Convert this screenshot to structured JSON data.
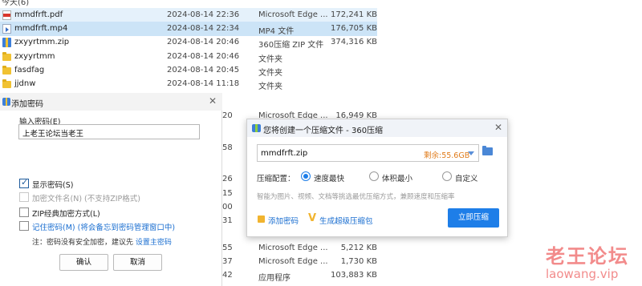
{
  "explorer": {
    "crumb": "今天(6)",
    "files": [
      {
        "name": "mmdfrft.pdf",
        "date": "2024-08-14 22:36",
        "type": "Microsoft Edge ...",
        "size": "172,241 KB",
        "icon": "pdf-icon"
      },
      {
        "name": "mmdfrft.mp4",
        "date": "2024-08-14 22:34",
        "type": "MP4 文件",
        "size": "176,705 KB",
        "icon": "mp4-icon"
      },
      {
        "name": "zxyyrtmm.zip",
        "date": "2024-08-14 20:46",
        "type": "360压缩 ZIP 文件",
        "size": "374,316 KB",
        "icon": "zip-icon"
      },
      {
        "name": "zxyyrtmm",
        "date": "2024-08-14 20:46",
        "type": "文件夹",
        "size": "",
        "icon": "folder-icon"
      },
      {
        "name": "fasdfag",
        "date": "2024-08-14 20:45",
        "type": "文件夹",
        "size": "",
        "icon": "folder-icon"
      },
      {
        "name": "jjdnw",
        "date": "2024-08-14 11:18",
        "type": "文件夹",
        "size": "",
        "icon": "folder-icon"
      }
    ],
    "partial_rows": [
      {
        "size_col": "20",
        "type": "Microsoft Edge ...",
        "size": "16,949 KB"
      },
      {
        "size_col": "58",
        "type": "",
        "size": ""
      },
      {
        "size_col": "26",
        "type": "",
        "size": ""
      },
      {
        "size_col": "15",
        "type": "",
        "size": ""
      },
      {
        "size_col": "00",
        "type": "",
        "size": ""
      },
      {
        "size_col": "31",
        "type": "",
        "size": ""
      },
      {
        "size_col": "55",
        "type": "Microsoft Edge ...",
        "size": "5,212 KB"
      },
      {
        "size_col": "37",
        "type": "Microsoft Edge ...",
        "size": "1,730 KB"
      },
      {
        "size_col": "42",
        "type": "应用程序",
        "size": "103,883 KB"
      }
    ]
  },
  "password_dialog": {
    "title": "添加密码",
    "close": "✕",
    "input_label": "输入密码(E)",
    "input_value": "上老王论坛当老王",
    "show_password": "显示密码(S)",
    "encrypt_names": "加密文件名(N) (不支持ZIP格式)",
    "zip_classic": "ZIP经典加密方式(L)",
    "remember": "记住密码(M) (将会备忘到密码管理窗口中)",
    "note": "注：密码没有安全加密，建议先 ",
    "note_link": "设置主密码",
    "ok": "确认",
    "cancel": "取消"
  },
  "zip_dialog": {
    "title": "您将创建一个压缩文件 - 360压缩",
    "close": "✕",
    "filename": "mmdfrft.zip",
    "free_space": "剩余:55.6GB",
    "config_label": "压缩配置：",
    "options": [
      "速度最快",
      "体积最小",
      "自定义"
    ],
    "selected_option": "速度最快",
    "hint": "智能为图片、视频、文档等挑选最优压缩方式，兼顾速度和压缩率",
    "add_password": "添加密码",
    "super_pack": "生成超级压缩包",
    "compress_now": "立即压缩"
  },
  "watermark": {
    "cn": "老王论坛",
    "url": "laowang.vip"
  },
  "colors": {
    "selection": "#cce4f7",
    "accent_blue": "#1e7ee8",
    "free_space_orange": "#e07b1a",
    "watermark": "#f28b8b"
  }
}
